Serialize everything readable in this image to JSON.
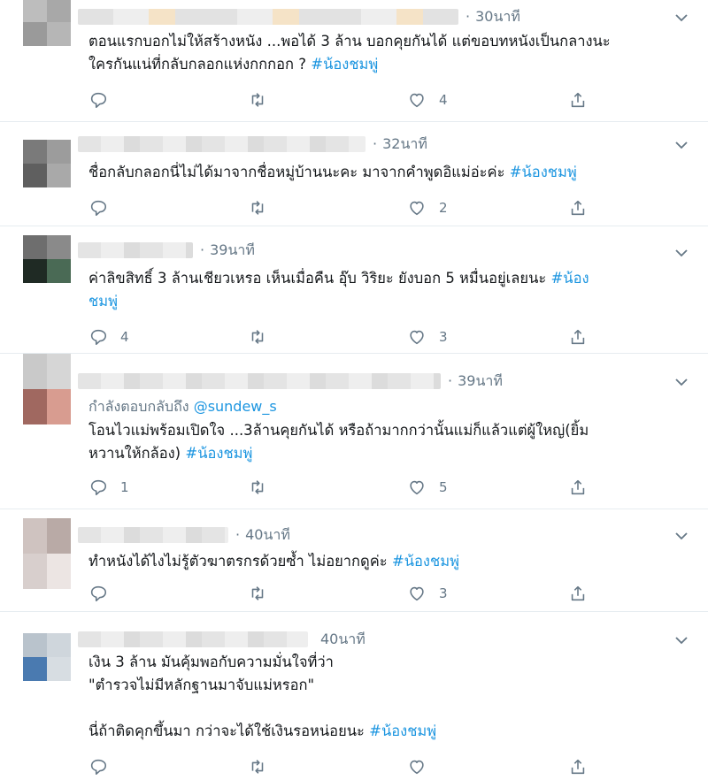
{
  "tweets": [
    {
      "time": "30นาที",
      "body_text": "ตอนแรกบอกไม่ให้สร้างหนัง ...พอได้ 3 ล้าน บอกคุยกันได้ แต่ขอบทหนังเป็นกลางนะ\nใครกันแน่ที่กลับกลอกแห่งกกกอก ? ",
      "hashtag": "#น้องชมพู่",
      "reply_count": "",
      "retweet_count": "",
      "like_count": "4"
    },
    {
      "time": "32นาที",
      "body_text": "ชื่อกลับกลอกนี่ไม่ได้มาจากชื่อหมู่บ้านนะคะ มาจากคำพูดอิแม่อ่ะค่ะ ",
      "hashtag": "#น้องชมพู่",
      "reply_count": "",
      "retweet_count": "",
      "like_count": "2"
    },
    {
      "time": "39นาที",
      "body_text": "ค่าลิขสิทธิ์ 3 ล้านเชียวเหรอ เห็นเมื่อคืน อุ๊บ วิริยะ ยังบอก 5 หมื่นอยู่เลยนะ ",
      "hashtag": "#น้อง\nชมพู่",
      "reply_count": "4",
      "retweet_count": "",
      "like_count": "3"
    },
    {
      "time": "39นาที",
      "replying_label": "กำลังตอบกลับถึง ",
      "replying_handle": "@sundew_s",
      "body_text": "โอนไวแม่พร้อมเปิดใจ ...3ล้านคุยกันได้ หรือถ้ามากกว่านั้นแม่ก็แล้วแต่ผู้ใหญ่(ยิ้ม\nหวานให้กล้อง) ",
      "hashtag": "#น้องชมพู่",
      "reply_count": "1",
      "retweet_count": "",
      "like_count": "5"
    },
    {
      "time": "40นาที",
      "body_text": "ทำหนังได้ไงไม่รู้ตัวฆาตรกรด้วยซ้ำ ไม่อยากดูค่ะ ",
      "hashtag": "#น้องชมพู่",
      "reply_count": "",
      "retweet_count": "",
      "like_count": "3"
    },
    {
      "time": "40นาที",
      "body_text": "เงิน 3 ล้าน มันคุ้มพอกับความมั่นใจที่ว่า\n\"ตำรวจไม่มีหลักฐานมาจับแม่หรอก\"\n\nนี่ถ้าติดคุกขึ้นมา กว่าจะได้ใช้เงินรอหน่อยนะ ",
      "hashtag": "#น้องชมพู่",
      "reply_count": "",
      "retweet_count": "",
      "like_count": ""
    }
  ],
  "colors": {
    "hashtag": "#1b95e0",
    "muted": "#657786",
    "divider": "#e6ecf0"
  },
  "icons": {
    "reply": "reply-icon",
    "retweet": "retweet-icon",
    "like": "heart-icon",
    "share": "share-icon",
    "more": "chevron-down-icon"
  }
}
